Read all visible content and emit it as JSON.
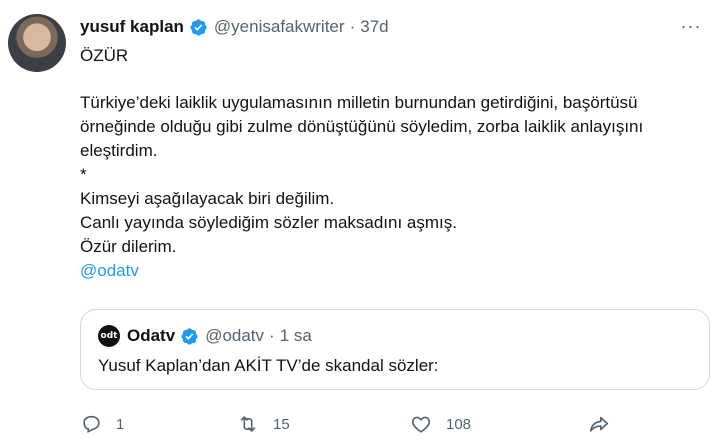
{
  "tweet": {
    "author_name": "yusuf kaplan",
    "handle": "@yenisafakwriter",
    "separator": "·",
    "time": "37d",
    "more_label": "···",
    "lines": [
      "ÖZÜR",
      "Türkiye’deki laiklik uygulamasının milletin burnundan getirdiğini, başörtüsü",
      "örneğinde olduğu gibi zulme dönüştüğünü söyledim, zorba laiklik anlayışını",
      "eleştirdim.",
      "*",
      "Kimseyi aşağılayacak biri değilim.",
      "Canlı yayında söylediğim sözler maksadını aşmış.",
      "Özür dilerim."
    ],
    "mention": "@odatv"
  },
  "quote": {
    "avatar_text": "odt",
    "author_name": "Odatv",
    "handle": "@odatv",
    "separator": "·",
    "time": "1 sa",
    "text": "Yusuf Kaplan’dan AKİT TV’de skandal sözler:"
  },
  "actions": {
    "reply_count": "1",
    "retweet_count": "15",
    "like_count": "108"
  },
  "colors": {
    "accent": "#1d9bf0",
    "secondary_text": "#536471",
    "border": "#cfd9de"
  }
}
